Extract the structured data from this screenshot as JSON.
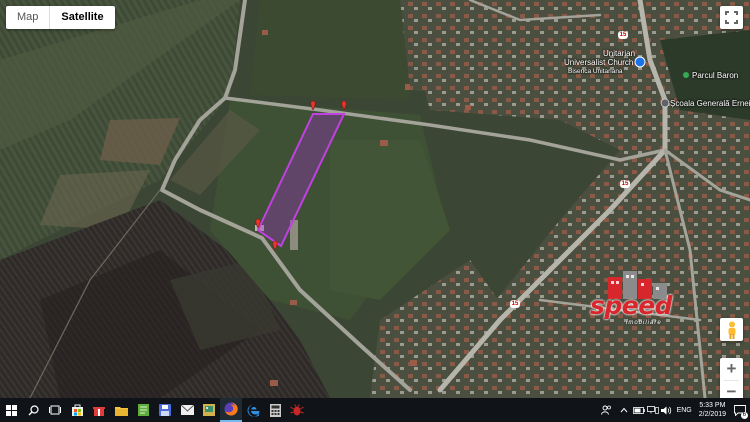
{
  "map_type": {
    "map_label": "Map",
    "satellite_label": "Satellite",
    "selected": "Satellite"
  },
  "places": {
    "church_line1": "Unitarian",
    "church_line2": "Universalist Church",
    "church_line3": "Biserica Unitariana",
    "park": "Parcul Baron",
    "school": "Școala Generală Ernei"
  },
  "roads": {
    "route_number": "15"
  },
  "watermark": {
    "brand": "speed",
    "tagline": "imobiliare"
  },
  "controls": {
    "zoom_in": "+",
    "zoom_out": "−"
  },
  "taskbar": {
    "language": "ENG",
    "time": "5:33 PM",
    "date": "2/2/2019",
    "notification_count": "6",
    "apps": [
      "start-icon",
      "search-icon",
      "task-view-icon",
      "store-icon",
      "gift-icon",
      "file-explorer-icon",
      "notepad-icon",
      "save-icon",
      "mail-icon",
      "photos-icon",
      "firefox-icon",
      "edge-icon",
      "calculator-icon",
      "cockroach-icon"
    ]
  },
  "colors": {
    "parcel_outline": "#c040e0",
    "parcel_fill": "#a030c8",
    "marker": "#e8362c",
    "taskbar": "#101418",
    "brand_red": "#d8262d"
  }
}
